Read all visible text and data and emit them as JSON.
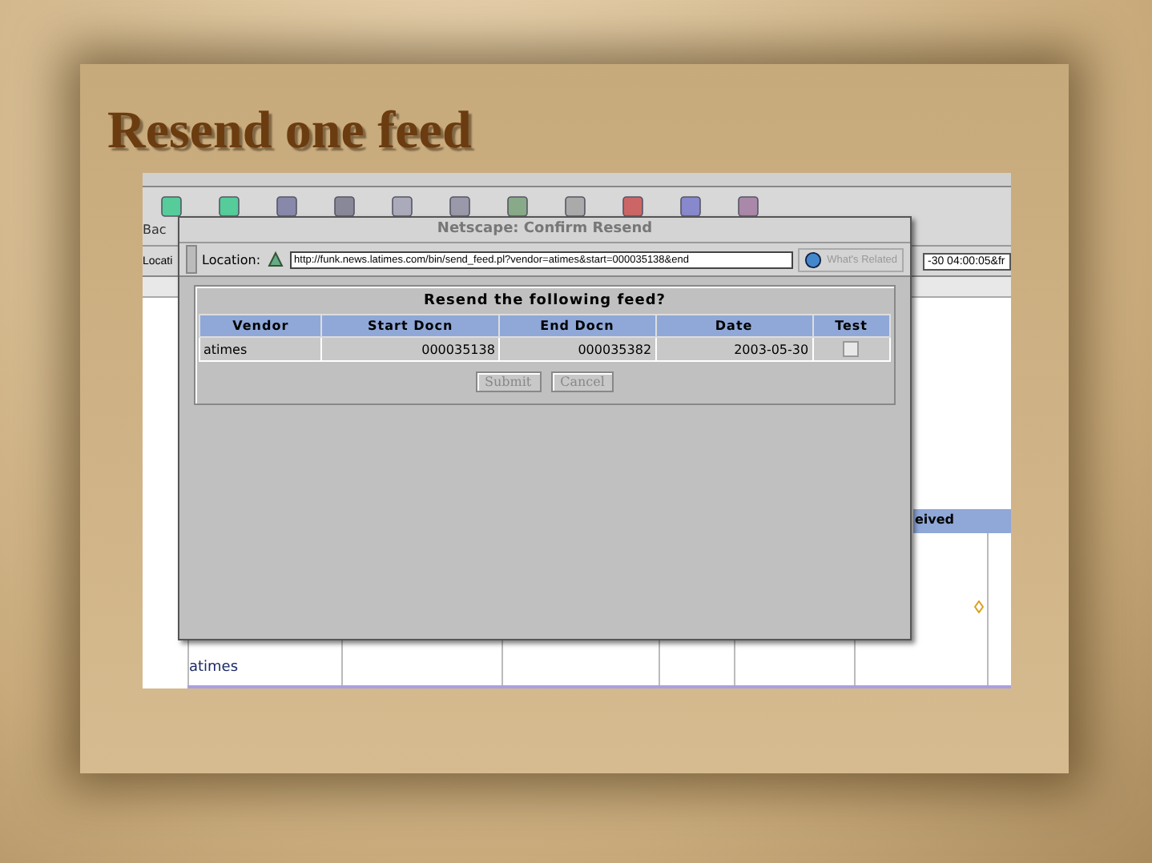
{
  "slide": {
    "title": "Resend one feed"
  },
  "browser": {
    "toolbar_label": "Bac",
    "location_label": "Locati",
    "url_tail": "-30 04:00:05&fr",
    "column_header": "eived",
    "row_cell": "atimes"
  },
  "dialog": {
    "title": "Netscape: Confirm Resend",
    "location_label": "Location:",
    "url": "http://funk.news.latimes.com/bin/send_feed.pl?vendor=atimes&start=000035138&end",
    "related": "What's Related",
    "heading": "Resend the following feed?",
    "table": {
      "columns": [
        "Vendor",
        "Start Docn",
        "End Docn",
        "Date",
        "Test"
      ],
      "rows": [
        {
          "vendor": "atimes",
          "start": "000035138",
          "end": "000035382",
          "date": "2003-05-30",
          "test_checked": false
        }
      ]
    },
    "buttons": [
      {
        "label": "Submit",
        "disabled": true
      },
      {
        "label": "Cancel",
        "disabled": true
      }
    ]
  }
}
